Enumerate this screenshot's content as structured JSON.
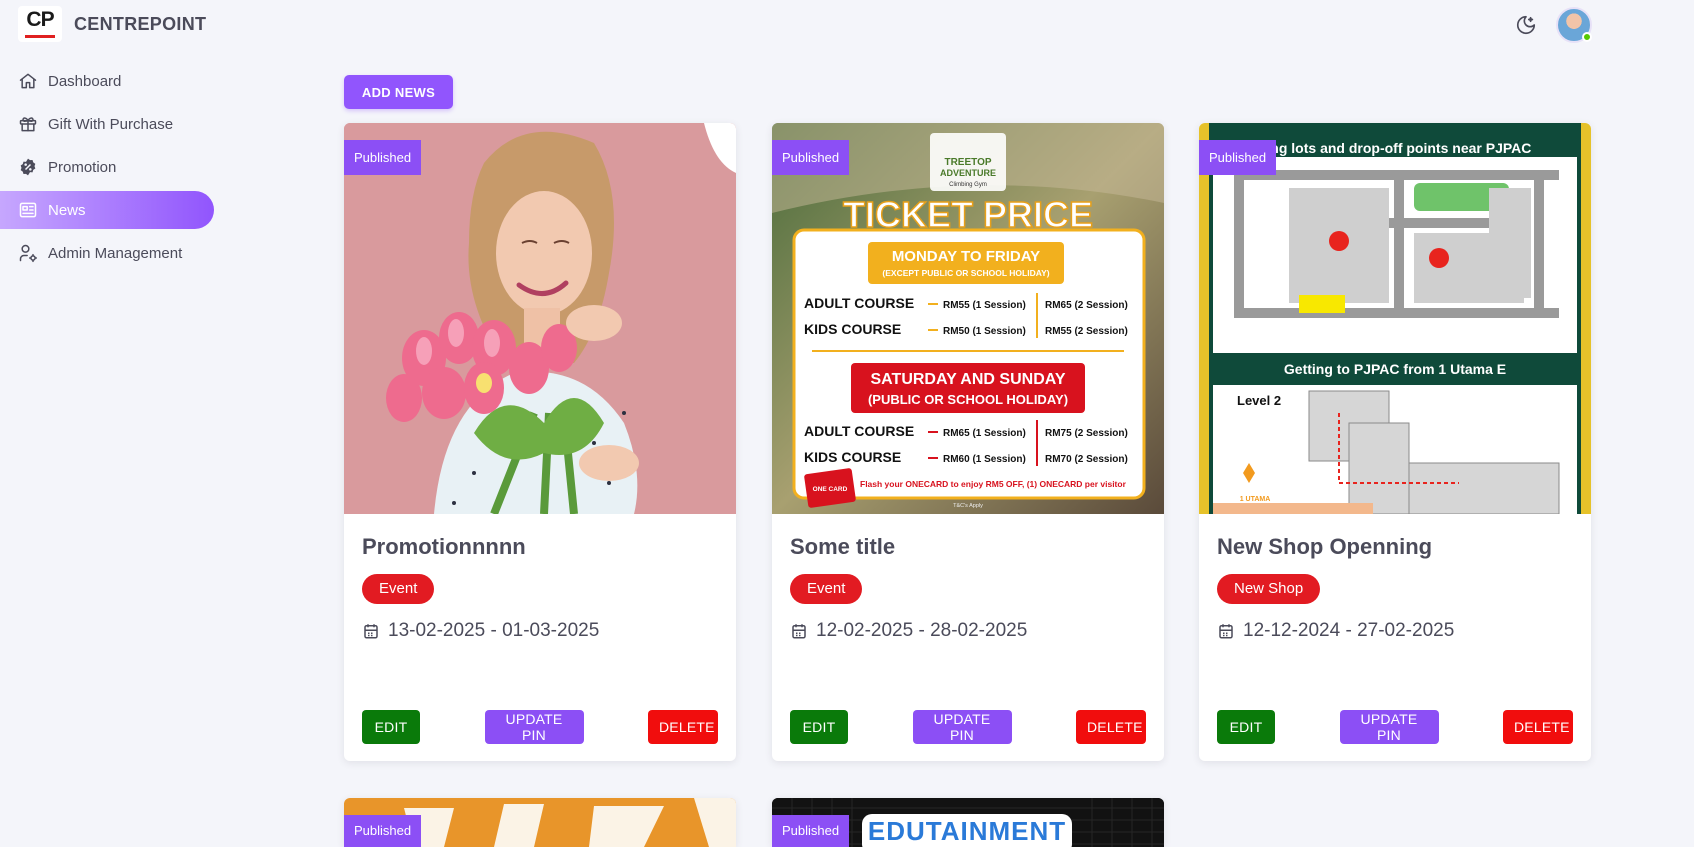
{
  "app": {
    "logo_text": "CP",
    "brand_name": "CENTREPOINT"
  },
  "header": {
    "theme_icon": "moon-icon",
    "avatar_icon": "user-avatar"
  },
  "sidebar": {
    "items": [
      {
        "label": "Dashboard",
        "icon": "home-icon"
      },
      {
        "label": "Gift With Purchase",
        "icon": "gift-icon"
      },
      {
        "label": "Promotion",
        "icon": "discount-badge-icon"
      },
      {
        "label": "News",
        "icon": "newspaper-icon",
        "active": true
      },
      {
        "label": "Admin Management",
        "icon": "user-cog-icon"
      }
    ]
  },
  "main": {
    "add_button": "ADD NEWS",
    "cards": [
      {
        "status": "Published",
        "title": "Promotionnnnn",
        "tag": "Event",
        "date_range": "13-02-2025 - 01-03-2025",
        "edit": "EDIT",
        "update_pin": "UPDATE PIN",
        "delete": "DELETE"
      },
      {
        "status": "Published",
        "title": "Some title",
        "tag": "Event",
        "date_range": "12-02-2025 - 28-02-2025",
        "edit": "EDIT",
        "update_pin": "UPDATE PIN",
        "delete": "DELETE",
        "poster": {
          "brand_line1": "TREETOP",
          "brand_line2": "ADVENTURE",
          "brand_line3": "Climbing Gym",
          "headline": "TICKET PRICE",
          "weekday_title": "MONDAY TO FRIDAY",
          "weekday_sub": "(EXCEPT PUBLIC OR SCHOOL HOLIDAY)",
          "weekday_rows": [
            {
              "course": "ADULT COURSE",
              "p1": "RM55 (1 Session)",
              "p2": "RM65 (2 Session)"
            },
            {
              "course": "KIDS COURSE",
              "p1": "RM50 (1 Session)",
              "p2": "RM55 (2 Session)"
            }
          ],
          "weekend_title": "SATURDAY AND SUNDAY",
          "weekend_sub": "(PUBLIC OR SCHOOL HOLIDAY)",
          "weekend_rows": [
            {
              "course": "ADULT COURSE",
              "p1": "RM65 (1 Session)",
              "p2": "RM75 (2 Session)"
            },
            {
              "course": "KIDS COURSE",
              "p1": "RM60 (1 Session)",
              "p2": "RM70 (2 Session)"
            }
          ],
          "card_label": "ONE CARD",
          "footer": "Flash your ONECARD to enjoy RM5 OFF, (1) ONECARD per visitor",
          "tc": "T&C's Apply"
        }
      },
      {
        "status": "Published",
        "title": "New Shop Openning",
        "tag": "New Shop",
        "date_range": "12-12-2024 - 27-02-2025",
        "edit": "EDIT",
        "update_pin": "UPDATE PIN",
        "delete": "DELETE",
        "poster": {
          "top_caption": "king lots and drop-off points near PJPAC",
          "mid_caption": "Getting to PJPAC from 1 Utama E",
          "level_label": "Level 2",
          "mall_label": "1 UTAMA"
        }
      },
      {
        "status": "Published"
      },
      {
        "status": "Published",
        "poster_text": "EDUTAINMENT"
      }
    ]
  },
  "colors": {
    "primary": "#9155fd",
    "tag_red": "#e21b22",
    "edit_green": "#0a7a0a",
    "delete_red": "#f10d0d",
    "background": "#f4f5fa"
  }
}
